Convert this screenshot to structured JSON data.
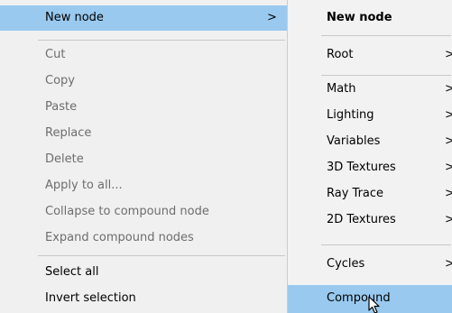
{
  "main_menu": {
    "items": [
      {
        "label": "New node",
        "arrow": ">"
      },
      {
        "label": "Cut"
      },
      {
        "label": "Copy"
      },
      {
        "label": "Paste"
      },
      {
        "label": "Replace"
      },
      {
        "label": "Delete"
      },
      {
        "label": "Apply to all..."
      },
      {
        "label": "Collapse to compound node"
      },
      {
        "label": "Expand compound nodes"
      },
      {
        "label": "Select all"
      },
      {
        "label": "Invert selection"
      }
    ]
  },
  "sub_menu": {
    "title": "New node",
    "items": [
      {
        "label": "Root",
        "arrow": ">"
      },
      {
        "label": "Math",
        "arrow": ">"
      },
      {
        "label": "Lighting",
        "arrow": ">"
      },
      {
        "label": "Variables",
        "arrow": ">"
      },
      {
        "label": "3D Textures",
        "arrow": ">"
      },
      {
        "label": "Ray Trace",
        "arrow": ">"
      },
      {
        "label": "2D Textures",
        "arrow": ">"
      },
      {
        "label": "Cycles",
        "arrow": ">"
      },
      {
        "label": "Compound"
      }
    ]
  },
  "colors": {
    "highlight": "#99c9ef",
    "disabled_text": "#6d6d6d",
    "menu_background": "#f0f0f0"
  },
  "icons": {
    "cursor": "mouse-pointer-icon"
  }
}
